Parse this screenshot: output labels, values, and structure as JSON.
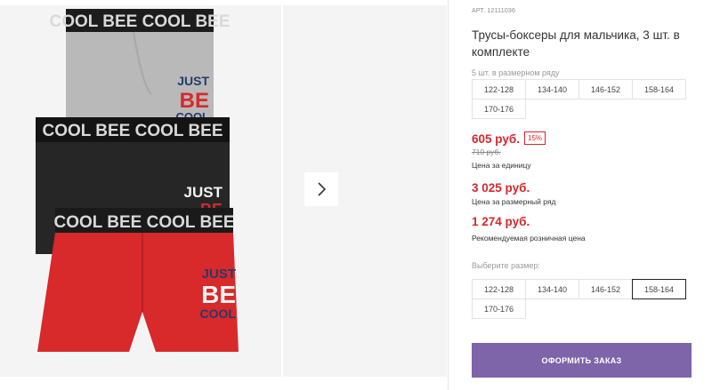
{
  "product": {
    "sku": "АРТ. 12111036",
    "title": "Трусы-боксеры для мальчика, 3 шт. в комплекте",
    "pack_note": "5 шт. в размерном ряду",
    "sizes": [
      "122-128",
      "134-140",
      "146-152",
      "158-164",
      "170-176"
    ]
  },
  "pricing": {
    "unit_price": "605 руб.",
    "discount": "15%",
    "old_price": "710 руб.",
    "unit_caption": "Цена за единицу",
    "range_price": "3 025 руб.",
    "range_caption": "Цена за размерный ряд",
    "retail_price": "1 274 руб.",
    "retail_caption": "Рекомендуемая розничная цена"
  },
  "size_picker": {
    "label": "Выберите размер:",
    "options": [
      "122-128",
      "134-140",
      "146-152",
      "158-164",
      "170-176"
    ],
    "selected": "158-164"
  },
  "order_button": {
    "label": "ОФОРМИТЬ ЗАКАЗ",
    "color": "#7e64a8"
  },
  "product_image": {
    "print_text_top": "JUST",
    "print_text_mid": "BE",
    "print_text_bottom": "COOL",
    "waistband_text": "COOL BEE COOL BEE",
    "colors": {
      "grey": "#b9b9b9",
      "black": "#262626",
      "red": "#d8292b"
    }
  },
  "icons": {
    "next": "chevron-right-icon"
  }
}
